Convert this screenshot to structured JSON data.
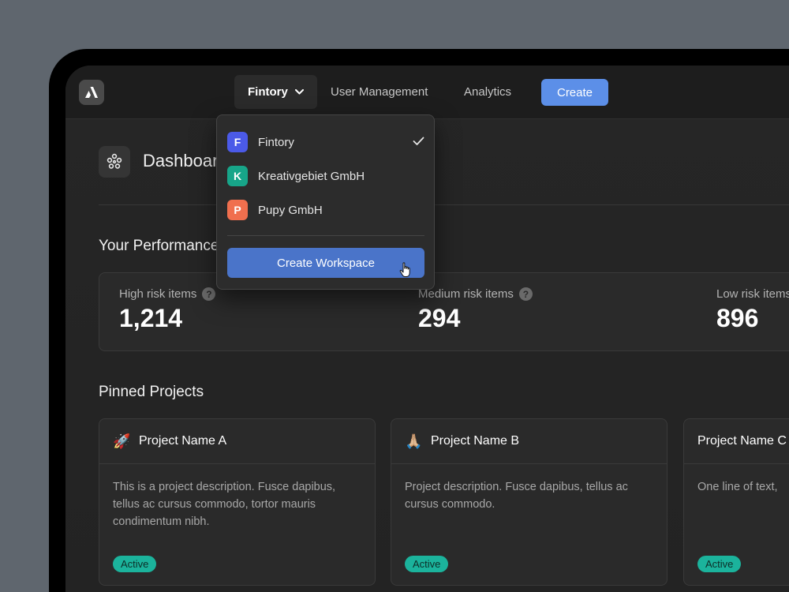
{
  "nav": {
    "workspace_label": "Fintory",
    "user_management": "User Management",
    "analytics": "Analytics",
    "create": "Create"
  },
  "dashboard": {
    "title": "Dashboard"
  },
  "performance": {
    "title": "Your Performance",
    "stats": [
      {
        "label": "High risk items",
        "value": "1,214"
      },
      {
        "label": "Medium risk items",
        "value": "294"
      },
      {
        "label": "Low risk items",
        "value": "896"
      }
    ]
  },
  "pinned": {
    "title": "Pinned Projects",
    "projects": [
      {
        "emoji": "🚀",
        "name": "Project Name A",
        "description": "This is a project description. Fusce dapibus, tellus ac cursus commodo, tortor mauris condimentum nibh.",
        "status": "Active"
      },
      {
        "emoji": "🙏🏼",
        "name": "Project Name B",
        "description": "Project description. Fusce dapibus, tellus ac cursus commodo.",
        "status": "Active"
      },
      {
        "emoji": "",
        "name": "Project Name C",
        "description": "One line of text, ",
        "status": "Active"
      }
    ]
  },
  "workspace_menu": {
    "items": [
      {
        "initial": "F",
        "name": "Fintory",
        "color": "#4b5ae8",
        "selected": true
      },
      {
        "initial": "K",
        "name": "Kreativgebiet GmbH",
        "color": "#17a589"
      },
      {
        "initial": "P",
        "name": "Pupy GmbH",
        "color": "#f06f4e"
      }
    ],
    "create_label": "Create Workspace"
  }
}
